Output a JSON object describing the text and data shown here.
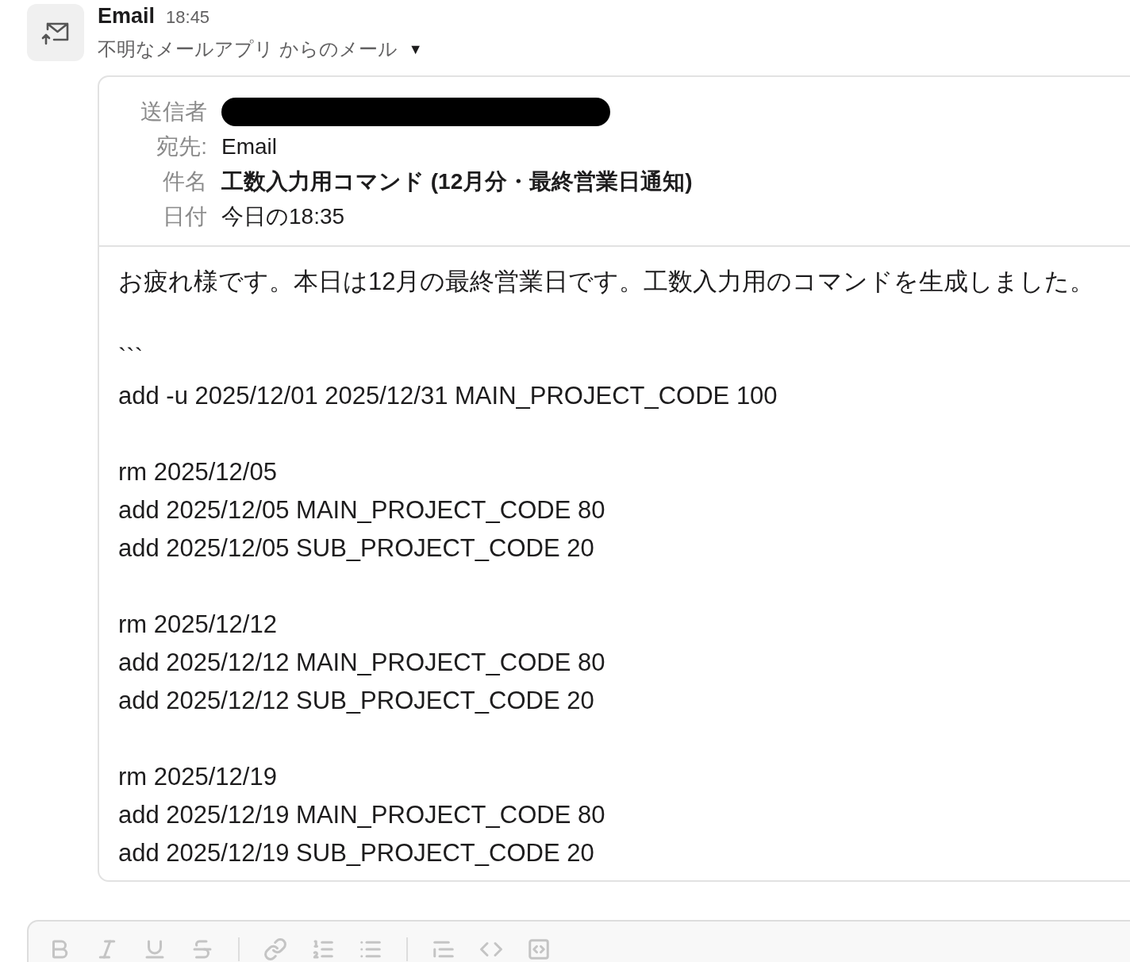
{
  "message": {
    "sender": "Email",
    "time": "18:45",
    "subtitle": "不明なメールアプリ からのメール",
    "menu_caret": "▼"
  },
  "email": {
    "fields": [
      {
        "label": "送信者",
        "redacted": true
      },
      {
        "label": "宛先:",
        "value": "Email",
        "bold": false
      },
      {
        "label": "件名",
        "value": "工数入力用コマンド (12月分・最終営業日通知)",
        "bold": true
      },
      {
        "label": "日付",
        "value": "今日の18:35",
        "bold": false
      }
    ],
    "body": [
      {
        "lines": [
          "お疲れ様です。本日は12月の最終営業日です。工数入力用のコマンドを生成しました。"
        ]
      },
      {
        "lines": [
          "```",
          "add -u 2025/12/01 2025/12/31 MAIN_PROJECT_CODE 100"
        ]
      },
      {
        "lines": [
          "rm 2025/12/05",
          "add 2025/12/05 MAIN_PROJECT_CODE 80",
          "add 2025/12/05 SUB_PROJECT_CODE 20"
        ]
      },
      {
        "lines": [
          "rm 2025/12/12",
          "add 2025/12/12 MAIN_PROJECT_CODE 80",
          "add 2025/12/12 SUB_PROJECT_CODE 20"
        ]
      },
      {
        "lines": [
          "rm 2025/12/19",
          "add 2025/12/19 MAIN_PROJECT_CODE 80",
          "add 2025/12/19 SUB_PROJECT_CODE 20"
        ]
      }
    ]
  },
  "composer": {
    "toolbar": [
      {
        "kind": "bold"
      },
      {
        "kind": "italic"
      },
      {
        "kind": "underline"
      },
      {
        "kind": "strike"
      },
      {
        "kind": "divider"
      },
      {
        "kind": "link"
      },
      {
        "kind": "ordered"
      },
      {
        "kind": "bullet"
      },
      {
        "kind": "divider"
      },
      {
        "kind": "quote"
      },
      {
        "kind": "code"
      },
      {
        "kind": "codeblock"
      }
    ]
  }
}
